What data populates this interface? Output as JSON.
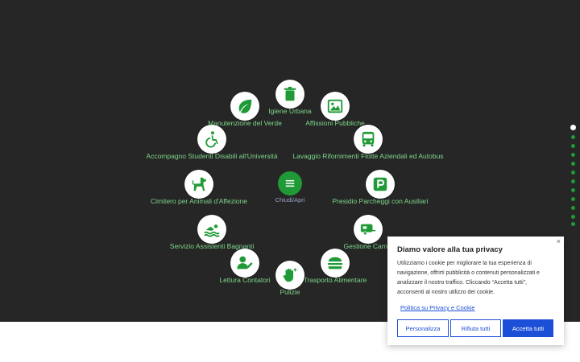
{
  "menu": {
    "center_label": "Chiudi/Apri",
    "accent_color": "#1f9a37",
    "label_color": "#7ed68a",
    "items": [
      {
        "label": "Igiene Urbana",
        "icon": "trash-icon"
      },
      {
        "label": "Affissioni Pubbliche",
        "icon": "image-icon"
      },
      {
        "label": "Lavaggio Rifornimenti Flotte Aziendali ed Autobus",
        "icon": "bus-icon"
      },
      {
        "label": "Presidio Parcheggi con Ausiliari",
        "icon": "parking-icon"
      },
      {
        "label": "Gestione Campi",
        "icon": "caravan-icon"
      },
      {
        "label": "Trasporto Alimentare",
        "icon": "burger-icon"
      },
      {
        "label": "Pulizie",
        "icon": "hand-sparkle-icon"
      },
      {
        "label": "Lettura Contatori",
        "icon": "user-edit-icon"
      },
      {
        "label": "Servizio Assistenti Bagnanti",
        "icon": "swimmer-icon"
      },
      {
        "label": "Cimitero per Animali d'Affezione",
        "icon": "dog-icon"
      },
      {
        "label": "Accompagno Studenti Disabili all'Università",
        "icon": "wheelchair-icon"
      },
      {
        "label": "Manutenzione del Verde",
        "icon": "leaf-icon"
      }
    ]
  },
  "cookie": {
    "title": "Diamo valore alla tua privacy",
    "text": "Utilizziamo i cookie per migliorare la tua esperienza di navigazione, offrirti pubblicità o contenuti personalizzati e analizzare il nostro traffico. Cliccando “Accetta tutti”, acconsenti al nostro utilizzo dei cookie.",
    "policy_link": "Politica su Privacy e Cookie",
    "close": "×",
    "buttons": {
      "customize": "Personalizza",
      "reject": "Rifiuta tutti",
      "accept": "Accetta tutti"
    },
    "primary_color": "#1b4fd8"
  }
}
